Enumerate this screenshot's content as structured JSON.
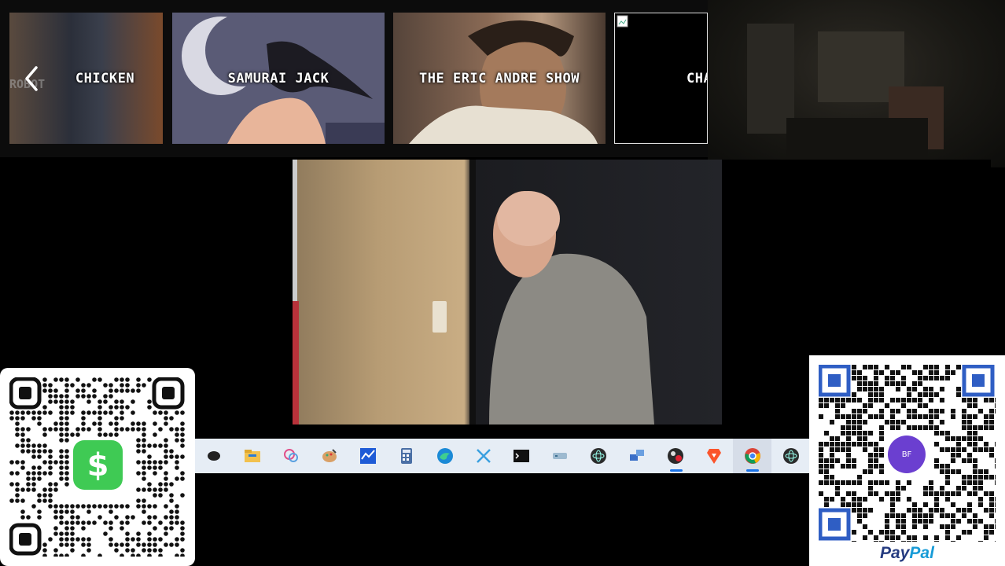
{
  "carousel": {
    "tiles": [
      {
        "label": "CHICKEN",
        "faded_prefix": "ROBOT"
      },
      {
        "label": "SAMURAI JACK"
      },
      {
        "label": "THE ERIC ANDRE SHOW"
      },
      {
        "label": "CHA"
      }
    ],
    "prev_icon": "chevron-left-icon"
  },
  "taskbar": {
    "apps": [
      {
        "icon": "mouse-icon",
        "color": "#222222"
      },
      {
        "icon": "file-explorer-icon",
        "color": "#f2c14e"
      },
      {
        "icon": "paint-3d-icon",
        "color": "#e0508a"
      },
      {
        "icon": "paint-palette-icon",
        "color": "#d9a066"
      },
      {
        "icon": "stock-chart-icon",
        "color": "#1e5bd6"
      },
      {
        "icon": "calculator-icon",
        "color": "#4a6fa5"
      },
      {
        "icon": "edge-browser-icon",
        "color": "#1b8ad6"
      },
      {
        "icon": "snipping-tool-icon",
        "color": "#3aa0e0"
      },
      {
        "icon": "terminal-icon",
        "color": "#111111"
      },
      {
        "icon": "remote-desktop-icon",
        "color": "#7aa7c7"
      },
      {
        "icon": "electron-app-icon",
        "color": "#2b2b2b"
      },
      {
        "icon": "network-icon",
        "color": "#3a6fc8"
      },
      {
        "icon": "obs-studio-icon",
        "color": "#2a2a2a",
        "active": true
      },
      {
        "icon": "brave-browser-icon",
        "color": "#fb542b"
      },
      {
        "icon": "chrome-browser-icon",
        "color": "#db4437",
        "selected": true
      },
      {
        "icon": "electron-app-icon",
        "color": "#2b2b2b"
      }
    ]
  },
  "qr_left": {
    "badge_text": "$",
    "badge_color": "#3fca54",
    "brand": "Cash App"
  },
  "qr_right": {
    "avatar_text": "BF",
    "avatar_color": "#6b3fd0",
    "logo_pay": "Pay",
    "logo_pal": "Pal",
    "finder_color": "#2f5ec4"
  }
}
